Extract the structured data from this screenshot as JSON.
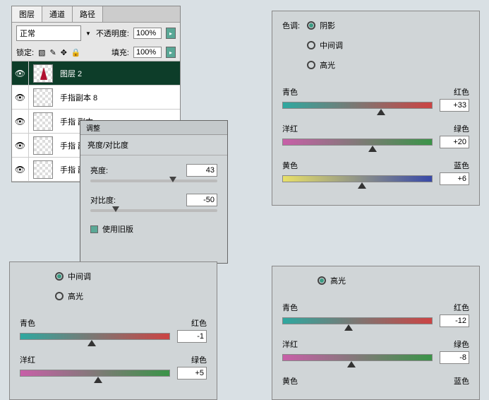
{
  "layers_panel": {
    "tabs": [
      "图层",
      "通道",
      "路径"
    ],
    "blend_mode": "正常",
    "opacity_label": "不透明度:",
    "opacity_value": "100%",
    "lock_label": "锁定:",
    "fill_label": "填充:",
    "fill_value": "100%",
    "layers": [
      {
        "name": "图层 2",
        "selected": true,
        "thumb": "red"
      },
      {
        "name": "手指副本 8",
        "selected": false
      },
      {
        "name": "手指 副本",
        "selected": false
      },
      {
        "name": "手指 副本",
        "selected": false
      },
      {
        "name": "手指 副本",
        "selected": false
      }
    ]
  },
  "adjust": {
    "tab": "调整",
    "title": "亮度/对比度",
    "rows": [
      {
        "label": "亮度:",
        "value": "43",
        "pos": 65
      },
      {
        "label": "对比度:",
        "value": "-50",
        "pos": 20
      }
    ],
    "legacy": "使用旧版"
  },
  "cb_top": {
    "tone_label": "色调:",
    "tones": [
      {
        "label": "阴影",
        "on": true
      },
      {
        "label": "中间调",
        "on": false
      },
      {
        "label": "高光",
        "on": false
      }
    ],
    "sliders": [
      {
        "left": "青色",
        "right": "红色",
        "value": "+33",
        "pos": 66,
        "grad": "grad-cr"
      },
      {
        "left": "洋红",
        "right": "绿色",
        "value": "+20",
        "pos": 60,
        "grad": "grad-mg"
      },
      {
        "left": "黄色",
        "right": "蓝色",
        "value": "+6",
        "pos": 53,
        "grad": "grad-yb"
      }
    ]
  },
  "cb_bl": {
    "tones": [
      {
        "label": "中间调",
        "on": true
      },
      {
        "label": "高光",
        "on": false
      }
    ],
    "sliders": [
      {
        "left": "青色",
        "right": "红色",
        "value": "-1",
        "pos": 48,
        "grad": "grad-cr"
      },
      {
        "left": "洋红",
        "right": "绿色",
        "value": "+5",
        "pos": 52,
        "grad": "grad-mg"
      }
    ]
  },
  "cb_br": {
    "tones": [
      {
        "label": "高光",
        "on": true
      }
    ],
    "sliders": [
      {
        "left": "青色",
        "right": "红色",
        "value": "-12",
        "pos": 44,
        "grad": "grad-cr"
      },
      {
        "left": "洋红",
        "right": "绿色",
        "value": "-8",
        "pos": 46,
        "grad": "grad-mg"
      }
    ],
    "partial": {
      "left": "黄色",
      "right": "蓝色"
    }
  }
}
